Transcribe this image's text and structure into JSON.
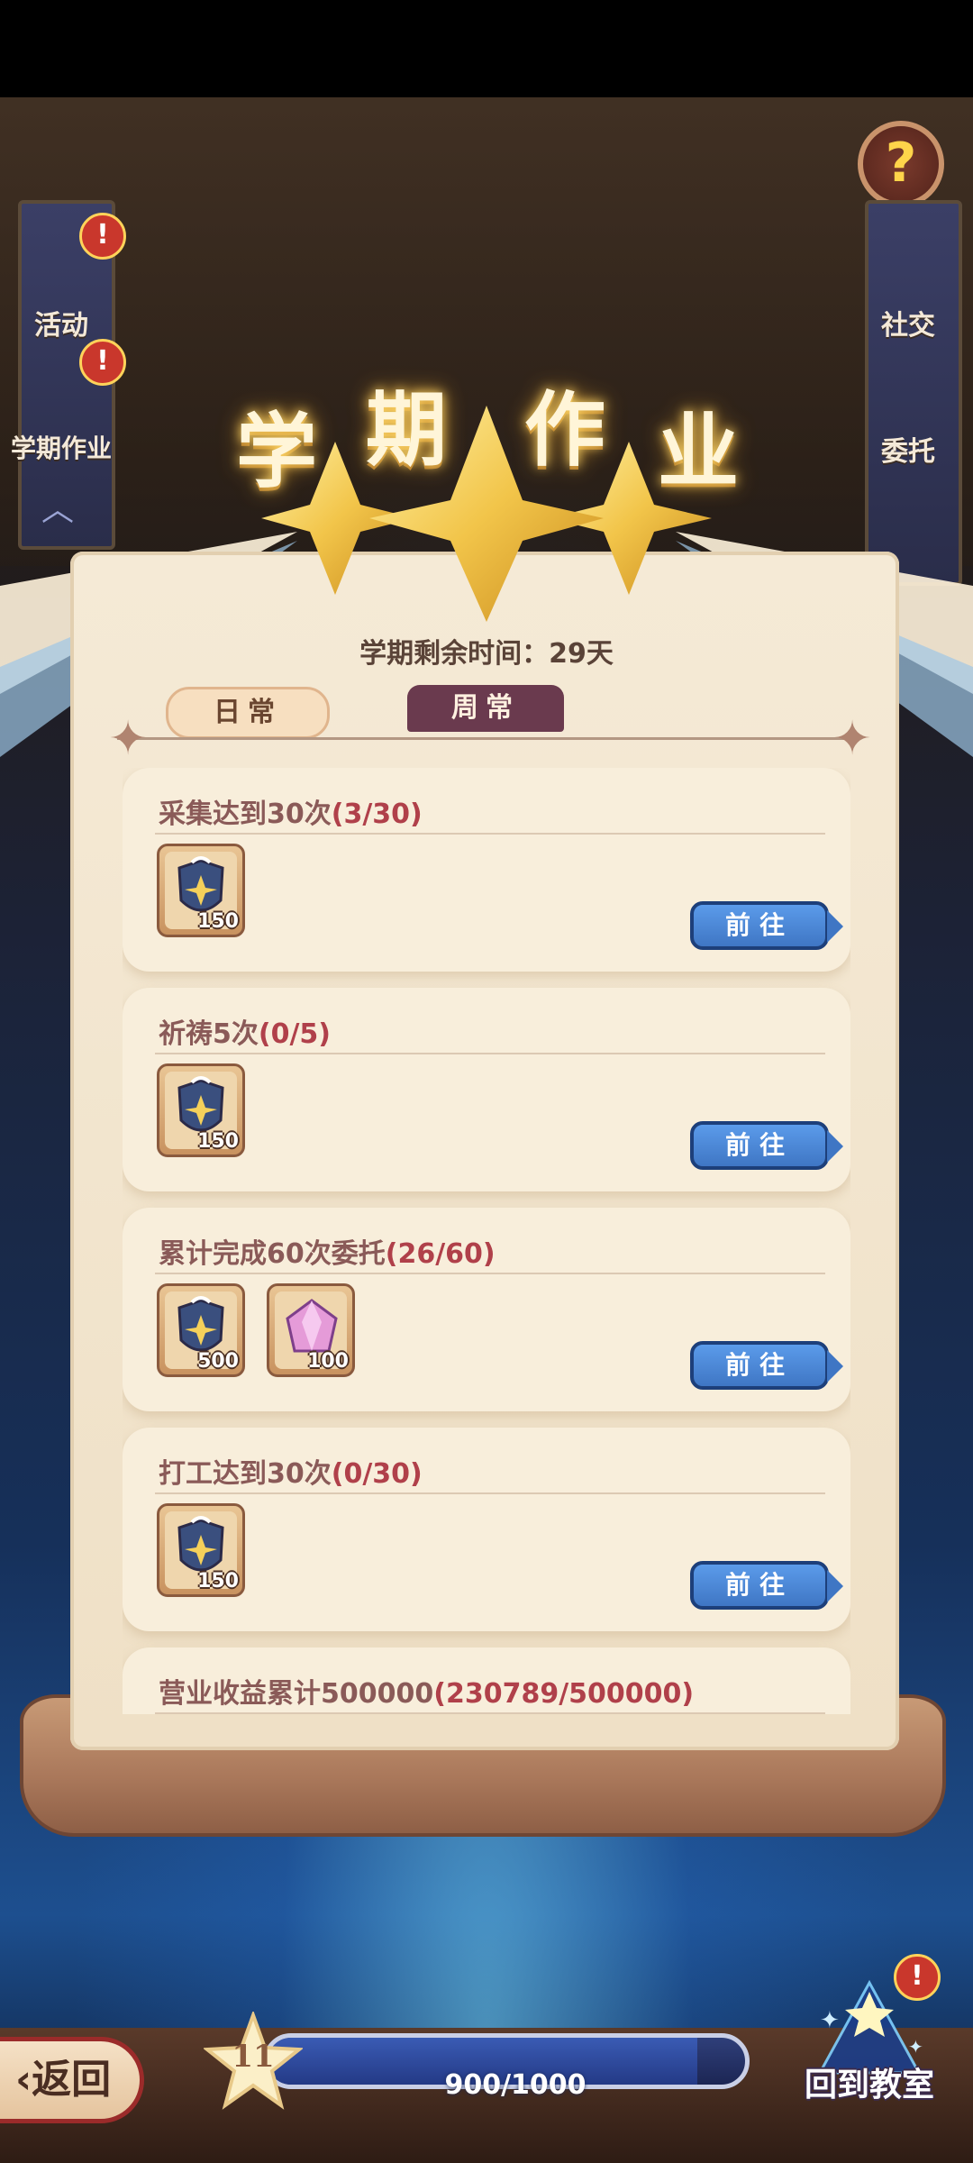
{
  "title": [
    "学",
    "期",
    "作",
    "业"
  ],
  "semester_remaining": "学期剩余时间：29天",
  "tabs": {
    "daily": "日常",
    "weekly": "周常",
    "selected": "weekly"
  },
  "left_menu": [
    {
      "label": "活动",
      "alert": "!"
    },
    {
      "label": "学期作业",
      "alert": "!"
    }
  ],
  "right_menu": [
    {
      "label": "社交"
    },
    {
      "label": "委托"
    }
  ],
  "help_icon": "?",
  "tasks": [
    {
      "title": "采集达到30次",
      "progress": "(3/30)",
      "rewards": [
        {
          "icon": "shield-badge-icon",
          "qty": "150"
        }
      ],
      "button": "前往"
    },
    {
      "title": "祈祷5次",
      "progress": "(0/5)",
      "rewards": [
        {
          "icon": "shield-badge-icon",
          "qty": "150"
        }
      ],
      "button": "前往"
    },
    {
      "title": "累计完成60次委托",
      "progress": "(26/60)",
      "rewards": [
        {
          "icon": "shield-badge-icon",
          "qty": "500"
        },
        {
          "icon": "pink-gem-icon",
          "qty": "100"
        }
      ],
      "button": "前往"
    },
    {
      "title": "打工达到30次",
      "progress": "(0/30)",
      "rewards": [
        {
          "icon": "shield-badge-icon",
          "qty": "150"
        }
      ],
      "button": "前往"
    },
    {
      "title": "营业收益累计500000",
      "progress": "(230789/500000)",
      "rewards": [],
      "button": ""
    }
  ],
  "bottom": {
    "back_label": "返回",
    "level": "11",
    "progress_text": "900/1000",
    "progress_value": 0.9,
    "classroom_label": "回到教室",
    "classroom_alert": "!"
  },
  "colors": {
    "task_title": "#8a5a58",
    "task_progress": "#b0404a",
    "button_blue": "#4a86d8",
    "tab_selected": "#6a3a4e"
  }
}
